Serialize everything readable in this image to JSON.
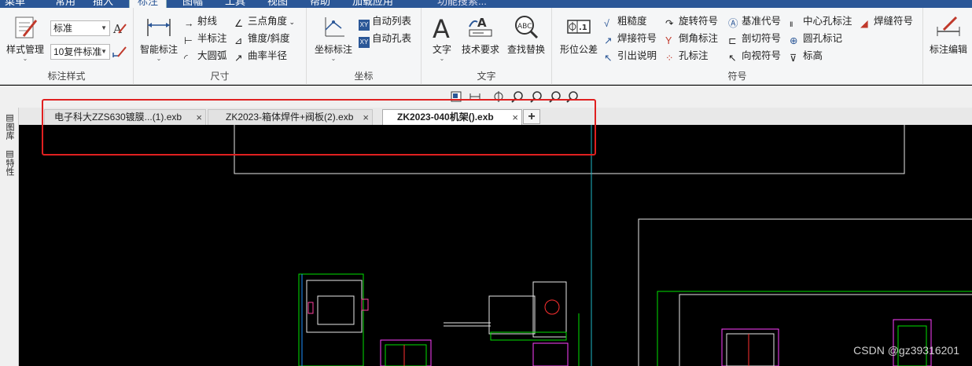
{
  "menu": {
    "tabs": [
      "菜单",
      "常用",
      "插入",
      "标注",
      "图幅",
      "工具",
      "视图",
      "帮助",
      "加载应用"
    ],
    "search": "功能搜索..."
  },
  "ribbon": {
    "groups": {
      "style": "标注样式",
      "dim": "尺寸",
      "coord": "坐标",
      "text": "文字",
      "symbol": "符号"
    },
    "style": {
      "manage": "样式管理",
      "text_style": "标准",
      "dim_style": "10复件标准"
    },
    "dim": {
      "smart": "智能标注",
      "ray": "射线",
      "half": "半标注",
      "big_arc": "大圆弧",
      "three_pt": "三点角度",
      "taper": "锥度/斜度",
      "curvature": "曲率半径"
    },
    "coord": {
      "coord_dim": "坐标标注",
      "auto_list": "自动列表",
      "auto_hole": "自动孔表"
    },
    "text": {
      "text": "文字",
      "tech_req": "技术要求",
      "find_replace": "查找替换"
    },
    "symbol": {
      "tolerance": "形位公差",
      "roughness": "粗糙度",
      "weld_sym": "焊接符号",
      "leader": "引出说明",
      "rotate": "旋转符号",
      "chamfer": "倒角标注",
      "hole": "孔标注",
      "datum": "基准代号",
      "section": "剖切符号",
      "view_dir": "向视符号",
      "center_hole": "中心孔标注",
      "round_hole": "圆孔标记",
      "elevation": "标高",
      "seam": "焊缝符号"
    },
    "edit": {
      "dim_edit": "标注编辑"
    }
  },
  "left_panel": {
    "library": "图库",
    "props": "特性"
  },
  "doc_tabs": [
    {
      "title": "电子科大ZZS630镀膜...(1).exb"
    },
    {
      "title": "ZK2023-箱体焊件+阀板(2).exb"
    },
    {
      "title": "ZK2023-040机架().exb"
    }
  ],
  "add_tab": "+",
  "close_glyph": "×",
  "watermark": "CSDN @gz39316201",
  "colors": {
    "accent": "#2b5797",
    "highlight": "#e02020",
    "canvas": "#000000"
  }
}
